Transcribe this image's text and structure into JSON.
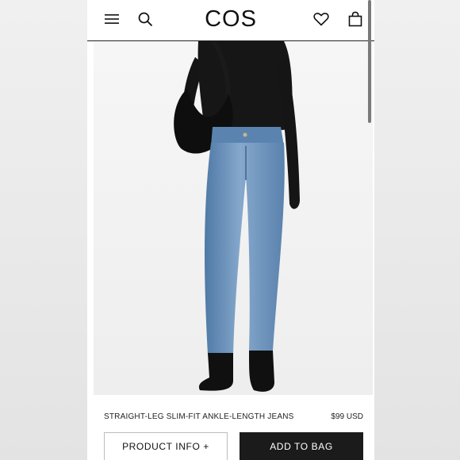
{
  "header": {
    "logo": "COS",
    "menu_icon": "hamburger-menu-icon",
    "search_icon": "search-icon",
    "wishlist_icon": "heart-icon",
    "bag_icon": "shopping-bag-icon"
  },
  "product": {
    "name": "STRAIGHT-LEG SLIM-FIT ANKLE-LENGTH JEANS",
    "price": "$99 USD"
  },
  "actions": {
    "product_info_label": "PRODUCT INFO +",
    "add_to_bag_label": "ADD TO BAG"
  },
  "colors": {
    "denim": "#6b8fb8",
    "black": "#1b1b1b"
  }
}
